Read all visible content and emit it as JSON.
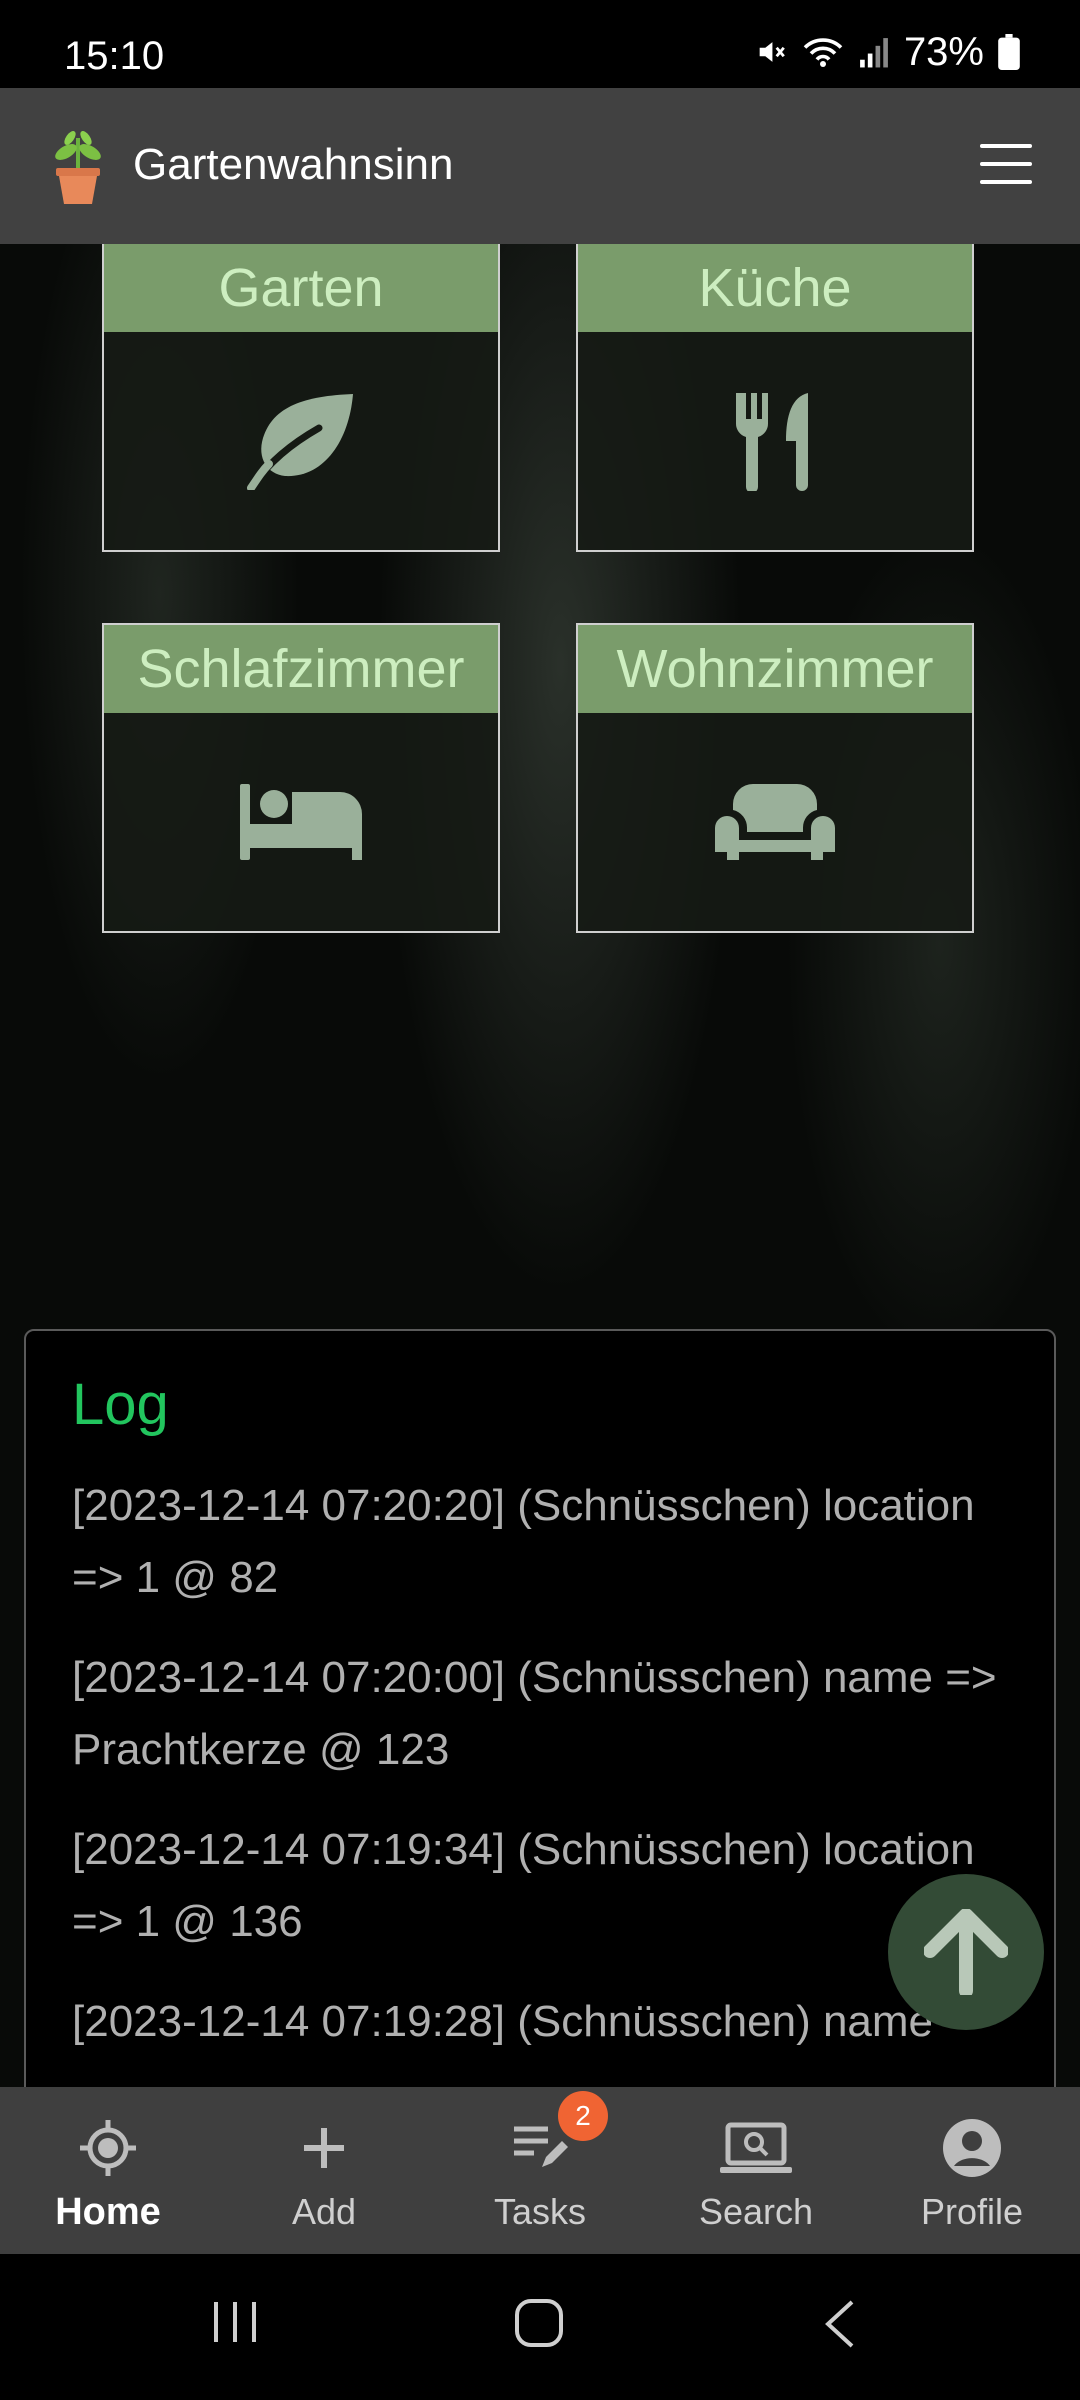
{
  "status_bar": {
    "time": "15:10",
    "battery": "73%"
  },
  "app": {
    "title": "Gartenwahnsinn"
  },
  "rooms": [
    {
      "label": "Garten",
      "icon": "leaf-icon"
    },
    {
      "label": "Küche",
      "icon": "fork-knife-icon"
    },
    {
      "label": "Schlafzimmer",
      "icon": "bed-icon"
    },
    {
      "label": "Wohnzimmer",
      "icon": "couch-icon"
    }
  ],
  "log": {
    "title": "Log",
    "entries": [
      "[2023-12-14 07:20:20] (Schnüsschen) location => 1 @ 82",
      "[2023-12-14 07:20:00] (Schnüsschen) name => Prachtkerze @ 123",
      "[2023-12-14 07:19:34] (Schnüsschen) location => 1 @ 136",
      "[2023-12-14 07:19:28] (Schnüsschen) name"
    ]
  },
  "nav": {
    "items": [
      {
        "label": "Home",
        "icon": "home-target-icon",
        "active": true
      },
      {
        "label": "Add",
        "icon": "plus-icon"
      },
      {
        "label": "Tasks",
        "icon": "tasks-icon",
        "badge": "2"
      },
      {
        "label": "Search",
        "icon": "search-laptop-icon"
      },
      {
        "label": "Profile",
        "icon": "profile-icon"
      }
    ]
  },
  "colors": {
    "tile_header": "#7a9c6b",
    "log_title": "#22c55e",
    "badge": "#f06433",
    "fab": "#334b36"
  }
}
